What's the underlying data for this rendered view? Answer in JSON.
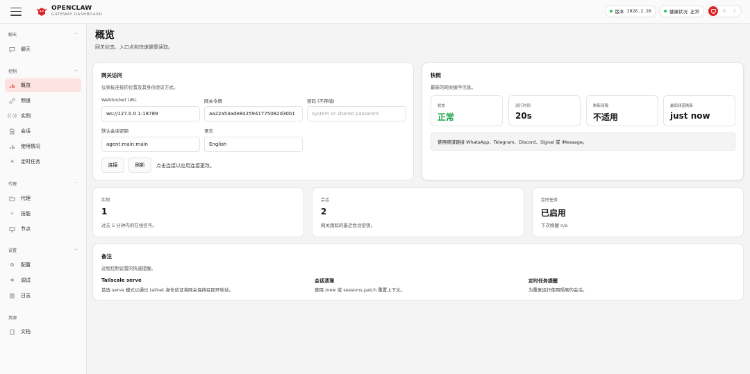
{
  "header": {
    "brand_title": "OPENCLAW",
    "brand_subtitle": "GATEWAY DASHBOARD",
    "version_label": "版本",
    "version_value": "2026.2.26",
    "health_label": "健康状况",
    "health_value": "正常",
    "status_color": "#22c55e",
    "accent_color": "#dc2626",
    "theme_options": [
      "monitor-icon",
      "sun-icon",
      "moon-icon"
    ],
    "theme_selected": "monitor-icon"
  },
  "sidebar": {
    "sections": [
      {
        "title": "聊天",
        "items": [
          {
            "label": "聊天",
            "icon": "chat-icon"
          }
        ]
      },
      {
        "title": "控制",
        "items": [
          {
            "label": "概览",
            "icon": "bar-chart-icon",
            "active": true
          },
          {
            "label": "频道",
            "icon": "link-icon"
          },
          {
            "label": "实例",
            "icon": "radio-icon"
          },
          {
            "label": "会话",
            "icon": "document-icon"
          },
          {
            "label": "使用情况",
            "icon": "bar-chart-icon"
          },
          {
            "label": "定时任务",
            "icon": "loader-icon"
          }
        ]
      },
      {
        "title": "代理",
        "items": [
          {
            "label": "代理",
            "icon": "folder-icon"
          },
          {
            "label": "技能",
            "icon": "sparkle-icon"
          },
          {
            "label": "节点",
            "icon": "monitor-icon"
          }
        ]
      },
      {
        "title": "设置",
        "items": [
          {
            "label": "配置",
            "icon": "gear-icon"
          },
          {
            "label": "调试",
            "icon": "bug-icon"
          },
          {
            "label": "日志",
            "icon": "log-icon"
          }
        ]
      },
      {
        "title": "资源",
        "items": [
          {
            "label": "文档",
            "icon": "book-icon"
          }
        ]
      }
    ]
  },
  "page": {
    "title": "概览",
    "subtitle": "网关状态、入口点和快速健康读取。"
  },
  "gateway_access": {
    "title": "网关访问",
    "subtitle": "仪表板连接的位置及其身份验证方式。",
    "websocket_label": "WebSocket URL",
    "websocket_value": "ws://127.0.0.1:18789",
    "token_label": "网关令牌",
    "token_value": "aa22a53ade8425941775082d30b1",
    "password_label": "密码 (不存储)",
    "password_placeholder": "system or shared password",
    "session_key_label": "默认会话密钥",
    "session_key_value": "agent:main:main",
    "language_label": "语言",
    "language_value": "English",
    "connect_button": "连接",
    "refresh_button": "刷新",
    "hint": "点击连接以应用连接更改。"
  },
  "snapshot": {
    "title": "快照",
    "subtitle": "最新的网关握手信息。",
    "stats": [
      {
        "label": "状态",
        "value": "正常"
      },
      {
        "label": "运行时间",
        "value": "20s"
      },
      {
        "label": "刷新间隔",
        "value": "不适用"
      },
      {
        "label": "最后频道刷新",
        "value": "just now"
      }
    ],
    "notice": "使用频道链接 WhatsApp、Telegram、Discord、Signal 或 iMessage。"
  },
  "summary_cards": [
    {
      "label": "实例",
      "value": "1",
      "desc": "过去 5 分钟内的在线信号。"
    },
    {
      "label": "会话",
      "value": "2",
      "desc": "网关跟踪的最近会话密钥。"
    },
    {
      "label": "定时任务",
      "value": "已启用",
      "desc": "下次唤醒 n/a"
    }
  ],
  "notes": {
    "title": "备注",
    "subtitle": "远程控制设置的快速提醒。",
    "items": [
      {
        "title": "Tailscale serve",
        "desc": "首选 serve 模式以通过 tailnet 身份验证将网关保持在回环地址。"
      },
      {
        "title": "会话清理",
        "desc": "使用 /new 或 sessions.patch 重置上下文。"
      },
      {
        "title": "定时任务提醒",
        "desc": "为重复运行使用隔离的会话。"
      }
    ]
  }
}
